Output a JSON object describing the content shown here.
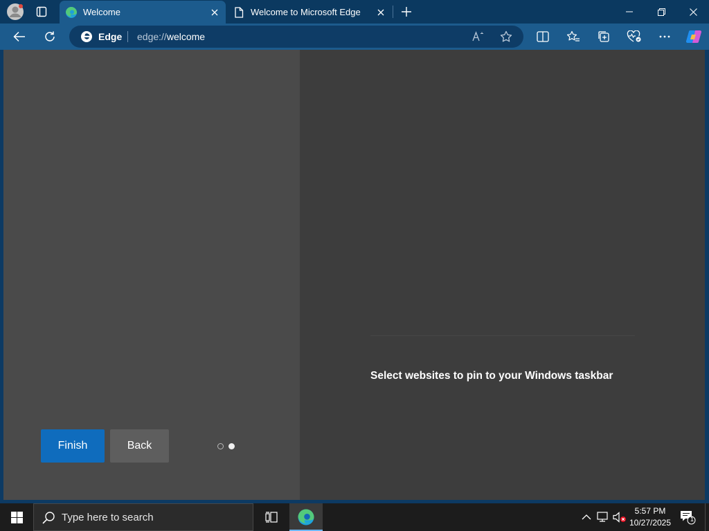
{
  "tabs": [
    {
      "title": "Welcome",
      "active": true,
      "favicon": "edge-icon"
    },
    {
      "title": "Welcome to Microsoft Edge",
      "active": false,
      "favicon": "page-icon"
    }
  ],
  "omnibox": {
    "brand": "Edge",
    "url_scheme": "edge://",
    "url_host": "welcome"
  },
  "content": {
    "finish_label": "Finish",
    "back_label": "Back",
    "heading": "Select websites to pin to your Windows taskbar",
    "steps_total": 2,
    "step_current": 2
  },
  "taskbar": {
    "search_placeholder": "Type here to search",
    "time": "5:57 PM",
    "date": "10/27/2025",
    "notification_count": "1"
  },
  "colors": {
    "accent": "#0f6cbd",
    "toolbar": "#1c5b8d",
    "tabstrip": "#0b3960",
    "content_bg": "#3d3d3d",
    "left_pane": "#4a4a4a"
  }
}
